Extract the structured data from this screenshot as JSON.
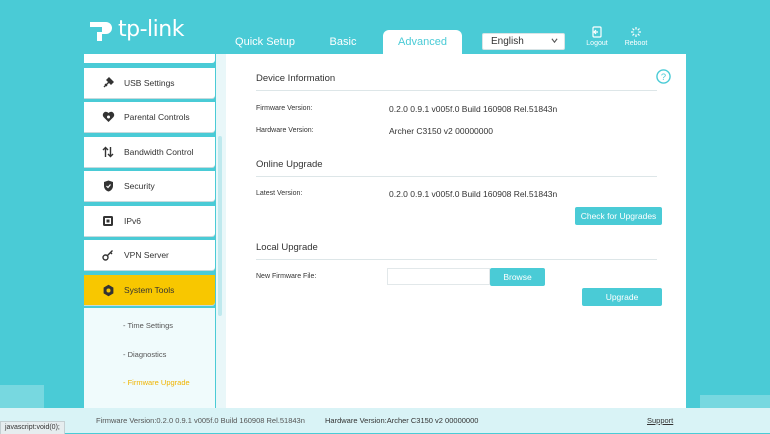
{
  "brand": {
    "logo_text": "tp-link"
  },
  "tabs": [
    {
      "label": "Quick Setup"
    },
    {
      "label": "Basic"
    },
    {
      "label": "Advanced"
    }
  ],
  "language": {
    "selected": "English"
  },
  "top_buttons": {
    "logout": "Logout",
    "reboot": "Reboot"
  },
  "sidebar": {
    "items": [
      {
        "label": "USB Settings",
        "icon": "usb-icon"
      },
      {
        "label": "Parental Controls",
        "icon": "heart-icon"
      },
      {
        "label": "Bandwidth Control",
        "icon": "arrows-updown-icon"
      },
      {
        "label": "Security",
        "icon": "shield-icon"
      },
      {
        "label": "IPv6",
        "icon": "ipv6-icon"
      },
      {
        "label": "VPN Server",
        "icon": "key-icon"
      },
      {
        "label": "System Tools",
        "icon": "gear-icon"
      }
    ],
    "subitems": [
      {
        "label": "- Time Settings"
      },
      {
        "label": "- Diagnostics"
      },
      {
        "label": "- Firmware Upgrade"
      }
    ],
    "active_color": "#f8c700"
  },
  "device_info": {
    "title": "Device Information",
    "firmware_label": "Firmware Version:",
    "firmware_value": "0.2.0 0.9.1 v005f.0 Build 160908 Rel.51843n",
    "hardware_label": "Hardware Version:",
    "hardware_value": "Archer C3150 v2 00000000"
  },
  "online_upgrade": {
    "title": "Online Upgrade",
    "latest_label": "Latest Version:",
    "latest_value": "0.2.0 0.9.1 v005f.0 Build 160908 Rel.51843n",
    "check_button": "Check for Upgrades"
  },
  "local_upgrade": {
    "title": "Local Upgrade",
    "file_label": "New Firmware File:",
    "file_value": "",
    "browse_button": "Browse",
    "upgrade_button": "Upgrade"
  },
  "footer": {
    "firmware": "Firmware Version:0.2.0 0.9.1 v005f.0 Build 160908 Rel.51843n",
    "hardware": "Hardware Version:Archer C3150 v2 00000000",
    "support": "Support"
  },
  "status_bar": "javascript:void(0);",
  "colors": {
    "accent": "#4acbd6",
    "active": "#f8c700",
    "submenu_active_text": "#f0b400"
  }
}
